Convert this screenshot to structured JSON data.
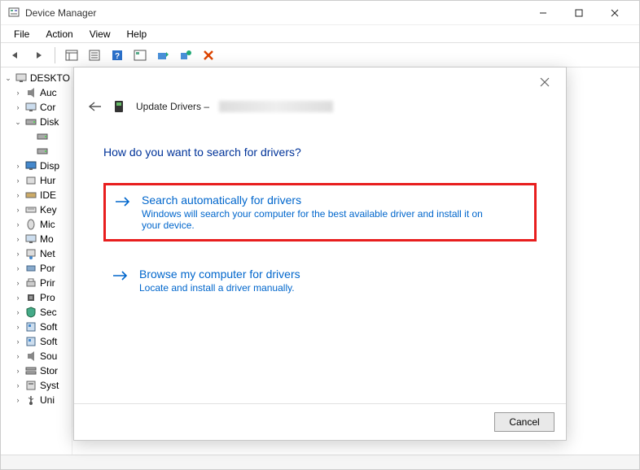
{
  "window": {
    "title": "Device Manager"
  },
  "menubar": [
    "File",
    "Action",
    "View",
    "Help"
  ],
  "tree": {
    "root": "DESKTO",
    "nodes": [
      {
        "label": "Auc",
        "expander": ">",
        "icon": "speaker"
      },
      {
        "label": "Cor",
        "expander": ">",
        "icon": "monitor"
      },
      {
        "label": "Disk",
        "expander": "v",
        "icon": "drive"
      },
      {
        "label": "",
        "expander": "",
        "icon": "drive",
        "depth": 2
      },
      {
        "label": "",
        "expander": "",
        "icon": "drive",
        "depth": 2
      },
      {
        "label": "Disp",
        "expander": ">",
        "icon": "display"
      },
      {
        "label": "Hur",
        "expander": ">",
        "icon": "hid"
      },
      {
        "label": "IDE",
        "expander": ">",
        "icon": "ide"
      },
      {
        "label": "Key",
        "expander": ">",
        "icon": "keyboard"
      },
      {
        "label": "Mic",
        "expander": ">",
        "icon": "mouse"
      },
      {
        "label": "Mo",
        "expander": ">",
        "icon": "monitor"
      },
      {
        "label": "Net",
        "expander": ">",
        "icon": "network"
      },
      {
        "label": "Por",
        "expander": ">",
        "icon": "port"
      },
      {
        "label": "Prir",
        "expander": ">",
        "icon": "printer"
      },
      {
        "label": "Pro",
        "expander": ">",
        "icon": "cpu"
      },
      {
        "label": "Sec",
        "expander": ">",
        "icon": "security"
      },
      {
        "label": "Soft",
        "expander": ">",
        "icon": "software"
      },
      {
        "label": "Soft",
        "expander": ">",
        "icon": "software"
      },
      {
        "label": "Sou",
        "expander": ">",
        "icon": "sound"
      },
      {
        "label": "Stor",
        "expander": ">",
        "icon": "storage"
      },
      {
        "label": "Syst",
        "expander": ">",
        "icon": "system"
      },
      {
        "label": "Uni",
        "expander": ">",
        "icon": "usb"
      }
    ]
  },
  "dialog": {
    "crumb": "Update Drivers –",
    "heading": "How do you want to search for drivers?",
    "options": [
      {
        "title": "Search automatically for drivers",
        "desc": "Windows will search your computer for the best available driver and install it on your device.",
        "highlight": true
      },
      {
        "title": "Browse my computer for drivers",
        "desc": "Locate and install a driver manually.",
        "highlight": false
      }
    ],
    "cancel": "Cancel"
  }
}
